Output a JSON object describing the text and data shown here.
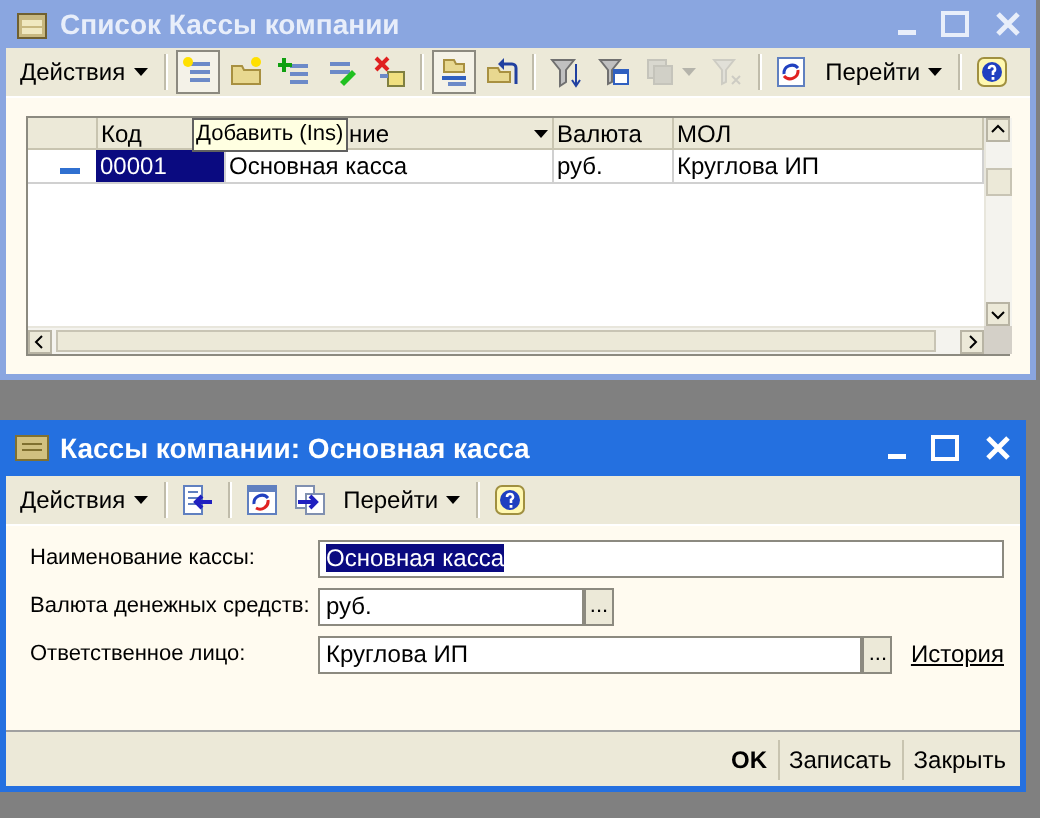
{
  "list_window": {
    "title": "Список Кассы компании",
    "active": false,
    "toolbar": [
      {
        "kind": "menu",
        "label": "Действия"
      },
      {
        "kind": "separator"
      },
      {
        "kind": "icon",
        "pressed": true,
        "disabled": false
      },
      {
        "kind": "icon",
        "pressed": false,
        "disabled": false
      },
      {
        "kind": "icon",
        "pressed": false,
        "disabled": false
      },
      {
        "kind": "icon",
        "pressed": false,
        "disabled": false
      },
      {
        "kind": "icon",
        "pressed": false,
        "disabled": false
      },
      {
        "kind": "separator"
      },
      {
        "kind": "icon",
        "pressed": true,
        "disabled": false
      },
      {
        "kind": "icon",
        "pressed": false,
        "disabled": false
      },
      {
        "kind": "separator"
      },
      {
        "kind": "icon",
        "pressed": false,
        "disabled": false
      },
      {
        "kind": "icon",
        "pressed": false,
        "disabled": false
      },
      {
        "kind": "dropdown-icon",
        "pressed": false,
        "disabled": true
      },
      {
        "kind": "icon",
        "pressed": false,
        "disabled": true
      },
      {
        "kind": "separator"
      },
      {
        "kind": "icon",
        "pressed": false,
        "disabled": false
      },
      {
        "kind": "menu",
        "label": "Перейти"
      },
      {
        "kind": "separator"
      },
      {
        "kind": "icon",
        "pressed": false,
        "disabled": false
      }
    ],
    "tooltip": "Добавить (Ins)",
    "table": {
      "columns": [
        {
          "label": "Код",
          "sort_menu": false
        },
        {
          "label": "ние",
          "sort_menu": true
        },
        {
          "label": "Валюта",
          "sort_menu": false
        },
        {
          "label": "МОЛ",
          "sort_menu": false
        }
      ],
      "rows": [
        {
          "cells": [
            {
              "text": "00001",
              "selected": true
            },
            {
              "text": "Основная касса",
              "selected": false
            },
            {
              "text": "руб.",
              "selected": false
            },
            {
              "text": "Круглова ИП",
              "selected": false
            }
          ]
        }
      ]
    }
  },
  "form_window": {
    "title": "Кассы компании: Основная касса",
    "active": true,
    "toolbar": [
      {
        "kind": "menu",
        "label": "Действия"
      },
      {
        "kind": "separator"
      },
      {
        "kind": "icon",
        "pressed": false,
        "disabled": false
      },
      {
        "kind": "separator"
      },
      {
        "kind": "icon",
        "pressed": false,
        "disabled": false
      },
      {
        "kind": "icon",
        "pressed": false,
        "disabled": false
      },
      {
        "kind": "menu",
        "label": "Перейти"
      },
      {
        "kind": "separator"
      },
      {
        "kind": "icon",
        "pressed": false,
        "disabled": false
      }
    ],
    "fields": [
      {
        "label": "Наименование кассы:",
        "value": "Основная касса",
        "selected": true
      },
      {
        "label": "Валюта денежных средств:",
        "value": "руб.",
        "selected": false,
        "choice_button": "..."
      },
      {
        "label": "Ответственное лицо:",
        "value": "Круглова ИП",
        "selected": false,
        "choice_button": "...",
        "link": "История"
      }
    ],
    "buttons": [
      {
        "label": "OK",
        "default": true
      },
      {
        "label": "Записать",
        "default": false
      },
      {
        "label": "Закрыть",
        "default": false
      }
    ]
  }
}
